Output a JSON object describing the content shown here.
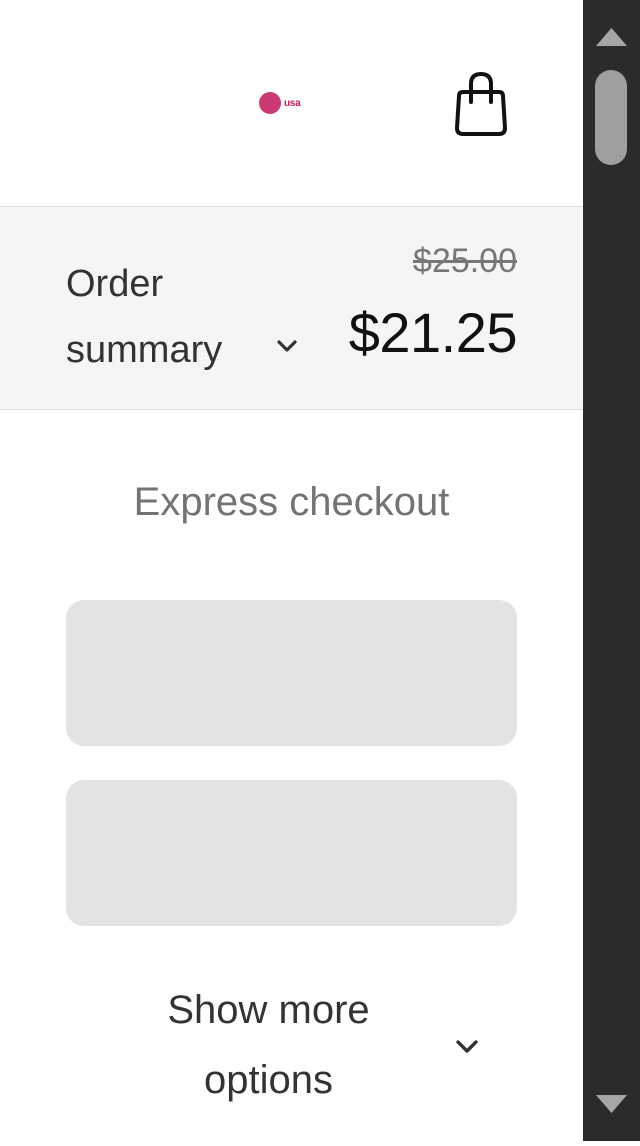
{
  "header": {
    "logo_text": "usa",
    "cart_icon": "shopping-bag-icon"
  },
  "order_summary": {
    "label": "Order summary",
    "toggle_icon": "chevron-down-icon",
    "original_price": "$25.00",
    "total_price": "$21.25"
  },
  "express_checkout": {
    "title": "Express checkout",
    "payment_buttons": [
      "",
      ""
    ],
    "show_more_label": "Show more options",
    "show_more_icon": "chevron-down-icon"
  },
  "scrollbar": {
    "up_icon": "triangle-up-icon",
    "down_icon": "triangle-down-icon"
  },
  "colors": {
    "summary_bg": "#f5f5f5",
    "button_placeholder": "#e3e3e3",
    "scrollbar_track": "#2b2b2b",
    "logo_accent": "#c2185b"
  }
}
